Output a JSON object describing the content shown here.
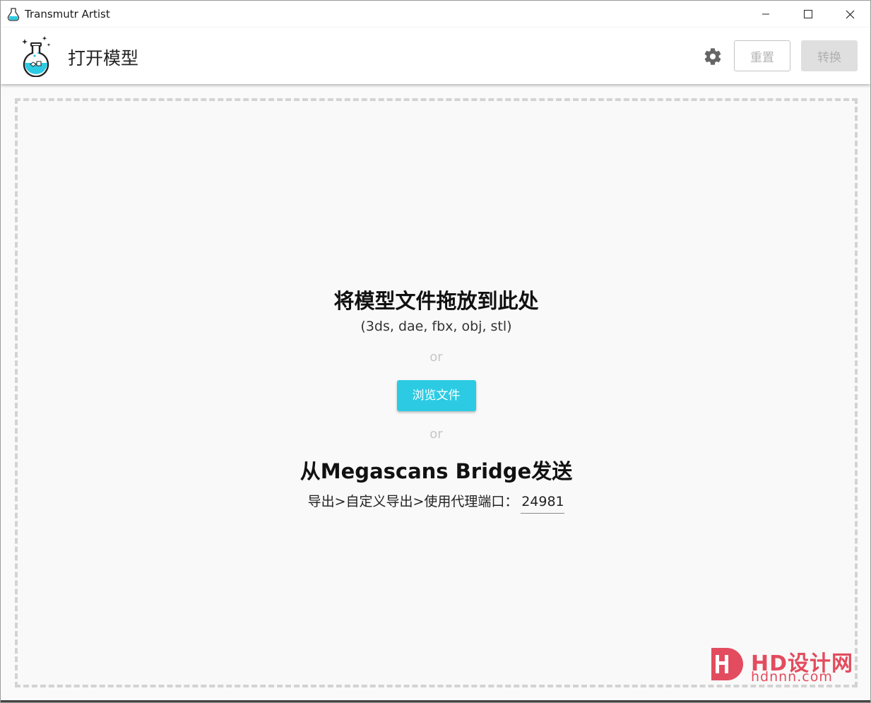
{
  "window": {
    "title": "Transmutr Artist"
  },
  "header": {
    "page_title": "打开模型",
    "settings_icon": "gear-icon",
    "reset_label": "重置",
    "convert_label": "转换"
  },
  "dropzone": {
    "heading": "将模型文件拖放到此处",
    "formats": "(3ds, dae, fbx, obj, stl)",
    "or_1": "or",
    "browse_label": "浏览文件",
    "or_2": "or",
    "bridge_heading": "从Megascans Bridge发送",
    "port_label": "导出>自定义导出>使用代理端口：",
    "port_value": "24981"
  },
  "watermark": {
    "text": "HD设计网",
    "url": "hdnnn.com"
  },
  "colors": {
    "accent": "#2ccbe3",
    "watermark": "#e34c5e"
  }
}
